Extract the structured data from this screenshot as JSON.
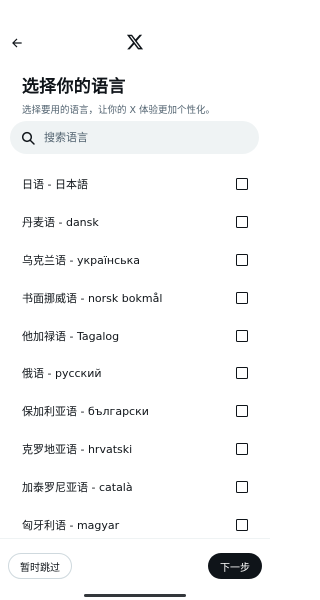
{
  "header": {
    "back_icon": "arrow-left-icon",
    "logo_icon": "x-logo-icon"
  },
  "page": {
    "title": "选择你的语言",
    "subtitle": "选择要用的语言，让你的 X 体验更加个性化。"
  },
  "search": {
    "placeholder": "搜索语言",
    "value": "",
    "icon": "search-icon"
  },
  "languages": [
    {
      "label": "日语 - 日本語",
      "checked": false
    },
    {
      "label": "丹麦语 - dansk",
      "checked": false
    },
    {
      "label": "乌克兰语 - українська",
      "checked": false
    },
    {
      "label": "书面挪威语 - norsk bokmål",
      "checked": false
    },
    {
      "label": "他加禄语 - Tagalog",
      "checked": false
    },
    {
      "label": "俄语 - русский",
      "checked": false
    },
    {
      "label": "保加利亚语 - български",
      "checked": false
    },
    {
      "label": "克罗地亚语 - hrvatski",
      "checked": false
    },
    {
      "label": "加泰罗尼亚语 - català",
      "checked": false
    },
    {
      "label": "匈牙利语 - magyar",
      "checked": false
    }
  ],
  "footer": {
    "skip_label": "暂时跳过",
    "next_label": "下一步"
  },
  "colors": {
    "primary_text": "#0f1419",
    "secondary_text": "#536471",
    "search_bg": "#eff3f4",
    "next_bg": "#0f1419"
  }
}
